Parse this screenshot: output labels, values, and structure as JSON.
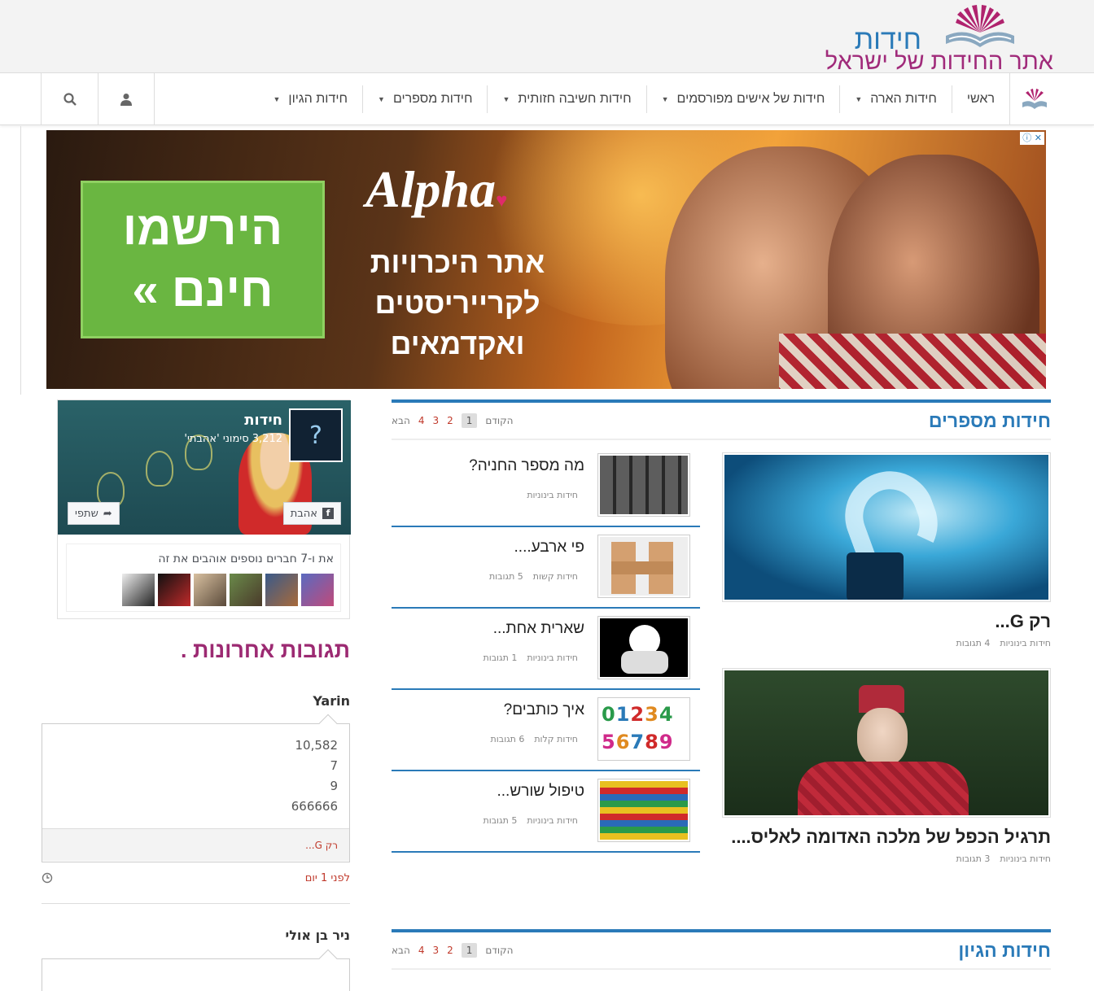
{
  "header": {
    "logo_title": "חידות",
    "logo_subtitle": "אתר החידות של ישראל"
  },
  "nav": {
    "items": [
      {
        "label": "ראשי"
      },
      {
        "label": "חידות הארה"
      },
      {
        "label": "חידות של אישים מפורסמים"
      },
      {
        "label": "חידות חשיבה חזותית"
      },
      {
        "label": "חידות מספרים"
      },
      {
        "label": "חידות הגיון"
      }
    ],
    "caret": "▼"
  },
  "ad": {
    "brand": "Alpha",
    "tagline_1": "אתר היכרויות",
    "tagline_2": "לקרייריסטים",
    "tagline_3": "ואקדמאים",
    "cta_1": "הירשמו",
    "cta_2": "חינם »",
    "info": "ⓘ ✕"
  },
  "facebook": {
    "page_name": "חידות",
    "likes": "3,212 סימוני 'אהבתי'",
    "like_btn": "אהבת",
    "share_btn": "שתפי",
    "friends_text": "את ו-7 חברים נוספים אוהבים את זה"
  },
  "comments": {
    "title": "תגובות אחרונות .",
    "items": [
      {
        "author": "Yarin",
        "lines": [
          "10,582",
          "7",
          "9",
          "666666"
        ],
        "post": "רק G...",
        "time": "לפני 1 יום"
      },
      {
        "author": "ניר בן אולי"
      }
    ]
  },
  "sections": [
    {
      "title": "חידות מספרים",
      "pager": {
        "prev": "הקודם",
        "current": "1",
        "pages": [
          "2",
          "3",
          "4"
        ],
        "next": "הבא"
      }
    },
    {
      "title": "חידות הגיון",
      "pager": {
        "prev": "הקודם",
        "current": "1",
        "pages": [
          "2",
          "3",
          "4"
        ],
        "next": "הבא"
      }
    }
  ],
  "featured": [
    {
      "title": "רק G...",
      "category": "חידות בינוניות",
      "comments": "4 תגובות"
    },
    {
      "title": "תרגיל הכפל של מלכה האדומה לאליס....",
      "category": "חידות בינוניות",
      "comments": "3 תגובות"
    }
  ],
  "list": [
    {
      "title": "מה מספר החניה?",
      "category": "חידות בינוניות",
      "comments": ""
    },
    {
      "title": "פי ארבע....",
      "category": "חידות קשות",
      "comments": "5 תגובות"
    },
    {
      "title": "שארית אחת...",
      "category": "חידות בינוניות",
      "comments": "1 תגובות"
    },
    {
      "title": "איך כותבים?",
      "category": "חידות קלות",
      "comments": "6 תגובות"
    },
    {
      "title": "טיפול שורש...",
      "category": "חידות בינוניות",
      "comments": "5 תגובות"
    }
  ],
  "colors": {
    "accent": "#2a7ab8",
    "brand": "#9c2a72",
    "link": "#c0392b"
  }
}
